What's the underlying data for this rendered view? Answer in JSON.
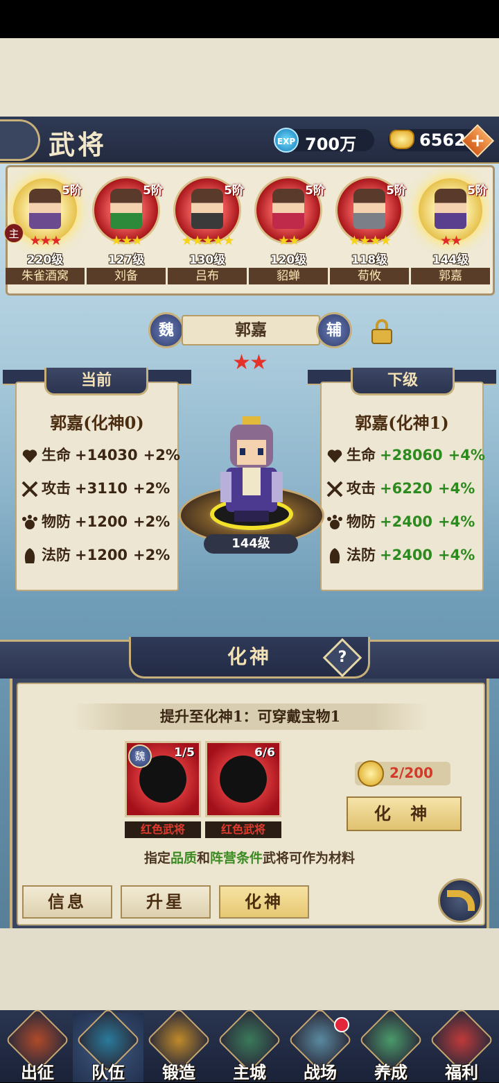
{
  "header": {
    "title": "武将",
    "exp_icon": "EXP",
    "exp_value": "700万",
    "gold_value": "6562"
  },
  "heroes": [
    {
      "tier": "5阶",
      "stars": "★★★",
      "star_color": "red",
      "level": "220级",
      "name": "朱雀酒窝",
      "ring": "gold",
      "skin": "#6b4a8f"
    },
    {
      "tier": "5阶",
      "stars": "★★★",
      "star_color": "yellow",
      "level": "127级",
      "name": "刘备",
      "ring": "red",
      "skin": "#2d8a3a"
    },
    {
      "tier": "5阶",
      "stars": "★★★★★",
      "star_color": "yellow",
      "level": "130级",
      "name": "吕布",
      "ring": "red",
      "skin": "#3a3a3a"
    },
    {
      "tier": "5阶",
      "stars": "★★",
      "star_color": "yellow",
      "level": "120级",
      "name": "貂蝉",
      "ring": "red",
      "skin": "#c02a4a"
    },
    {
      "tier": "5阶",
      "stars": "★★★★",
      "star_color": "yellow",
      "level": "118级",
      "name": "荀攸",
      "ring": "red",
      "skin": "#7a7f88"
    },
    {
      "tier": "5阶",
      "stars": "★★",
      "star_color": "red",
      "level": "144级",
      "name": "郭嘉",
      "ring": "gold",
      "skin": "#5b3f8f"
    }
  ],
  "main_badge": "主",
  "selected": {
    "faction": "魏",
    "name": "郭嘉",
    "role": "辅",
    "stars": "★★",
    "level": "144级"
  },
  "current": {
    "header": "当前",
    "title": "郭嘉(化神0)",
    "stats": [
      {
        "label": "生命",
        "value": "+14030",
        "pct": "+2%",
        "icon": "heart-icon"
      },
      {
        "label": "攻击",
        "value": "+3110",
        "pct": "+2%",
        "icon": "crossed-swords-icon"
      },
      {
        "label": "物防",
        "value": "+1200",
        "pct": "+2%",
        "icon": "paw-shield-icon"
      },
      {
        "label": "法防",
        "value": "+1200",
        "pct": "+2%",
        "icon": "helmet-icon"
      }
    ]
  },
  "next": {
    "header": "下级",
    "title": "郭嘉(化神1)",
    "stats": [
      {
        "label": "生命",
        "value": "+28060",
        "pct": "+4%",
        "icon": "heart-icon"
      },
      {
        "label": "攻击",
        "value": "+6220",
        "pct": "+4%",
        "icon": "crossed-swords-icon"
      },
      {
        "label": "物防",
        "value": "+2400",
        "pct": "+4%",
        "icon": "paw-shield-icon"
      },
      {
        "label": "法防",
        "value": "+2400",
        "pct": "+4%",
        "icon": "helmet-icon"
      }
    ]
  },
  "huashen": {
    "title": "化神",
    "help": "?",
    "requirement": "提升至化神1：可穿戴宝物1",
    "materials": [
      {
        "count": "1/5",
        "label": "红色武将",
        "faction": "魏"
      },
      {
        "count": "6/6",
        "label": "红色武将",
        "faction": ""
      }
    ],
    "coin": "2/200",
    "button": "化 神",
    "hint_parts": [
      "指定",
      "品质",
      "和",
      "阵营条件",
      "武将可作为材料"
    ]
  },
  "tabs": [
    "信息",
    "升星",
    "化神"
  ],
  "nav": [
    {
      "label": "出征",
      "color": "#b04a2a"
    },
    {
      "label": "队伍",
      "color": "#2a7a9a"
    },
    {
      "label": "锻造",
      "color": "#c08a2a"
    },
    {
      "label": "主城",
      "color": "#3a7a5a"
    },
    {
      "label": "战场",
      "color": "#5a8aa0"
    },
    {
      "label": "养成",
      "color": "#4a9a6a"
    },
    {
      "label": "福利",
      "color": "#c03a3a"
    }
  ]
}
